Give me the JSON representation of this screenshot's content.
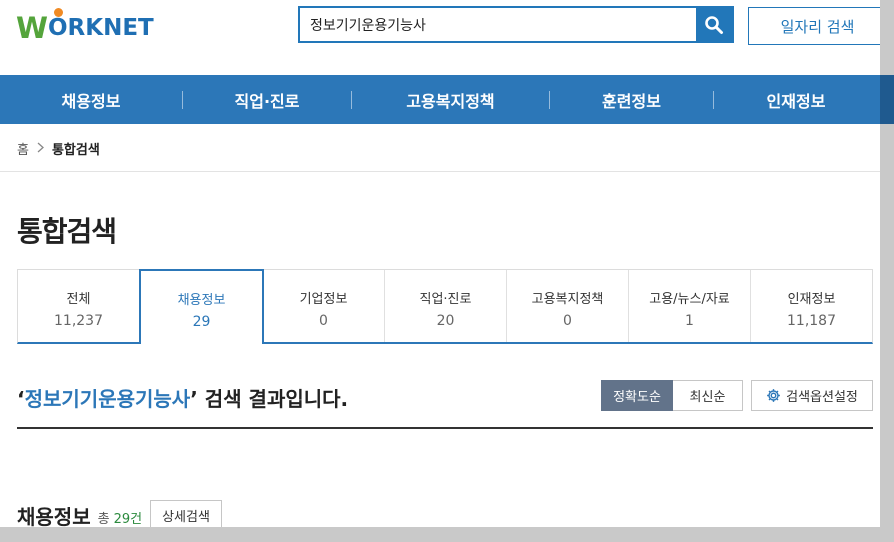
{
  "header": {
    "logo_first": "W",
    "logo_rest": "ORKNET",
    "search_value": "정보기기운용기능사",
    "job_search_label": "일자리 검색"
  },
  "nav": [
    "채용정보",
    "직업·진로",
    "고용복지정책",
    "훈련정보",
    "인재정보"
  ],
  "breadcrumb": {
    "home": "홈",
    "current": "통합검색"
  },
  "page_title": "통합검색",
  "tabs": [
    {
      "label": "전체",
      "count": "11,237"
    },
    {
      "label": "채용정보",
      "count": "29"
    },
    {
      "label": "기업정보",
      "count": "0"
    },
    {
      "label": "직업·진로",
      "count": "20"
    },
    {
      "label": "고용복지정책",
      "count": "0"
    },
    {
      "label": "고용/뉴스/자료",
      "count": "1"
    },
    {
      "label": "인재정보",
      "count": "11,187"
    }
  ],
  "result": {
    "open_quote": "‘",
    "keyword": "정보기기운용기능사",
    "close_quote": "’",
    "suffix": " 검색 결과입니다."
  },
  "sort": {
    "accuracy": "정확도순",
    "latest": "최신순"
  },
  "options_label": "검색옵션설정",
  "section": {
    "title": "채용정보",
    "total_label": "총",
    "count": "29건",
    "detail_label": "상세검색"
  },
  "colors": {
    "primary": "#2c77b8",
    "logo_green": "#54a43b",
    "logo_orange": "#f08a23",
    "sort_active": "#62738a"
  }
}
